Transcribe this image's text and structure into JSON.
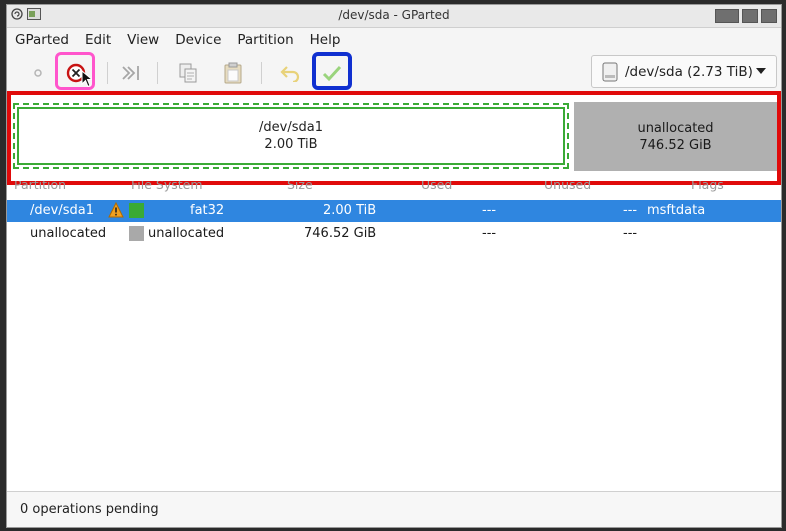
{
  "window": {
    "title": "/dev/sda - GParted"
  },
  "menu": [
    "GParted",
    "Edit",
    "View",
    "Device",
    "Partition",
    "Help"
  ],
  "toolbar": {
    "device_selector": "/dev/sda (2.73 TiB)"
  },
  "disk_map": {
    "partitions": [
      {
        "name": "/dev/sda1",
        "size": "2.00 TiB",
        "color": "#3aaa35"
      },
      {
        "name": "unallocated",
        "size": "746.52 GiB",
        "color": "#b0b0b0"
      }
    ]
  },
  "table": {
    "columns": [
      "Partition",
      "File System",
      "Size",
      "Used",
      "Unused",
      "Flags"
    ],
    "rows": [
      {
        "partition": "/dev/sda1",
        "filesystem": "fat32",
        "size": "2.00 TiB",
        "used": "---",
        "unused": "---",
        "flags": "msftdata",
        "fs_color": "#3aaa35",
        "warning": true
      },
      {
        "partition": "unallocated",
        "filesystem": "unallocated",
        "size": "746.52 GiB",
        "used": "---",
        "unused": "---",
        "flags": "",
        "fs_color": "#a9a9a9",
        "warning": false
      }
    ]
  },
  "status": {
    "text": "0 operations pending"
  },
  "colors": {
    "selection": "#2f86e0",
    "annotation_red": "#e00a0a",
    "annotation_pink": "#ff55cc",
    "annotation_blue": "#1030d0"
  }
}
